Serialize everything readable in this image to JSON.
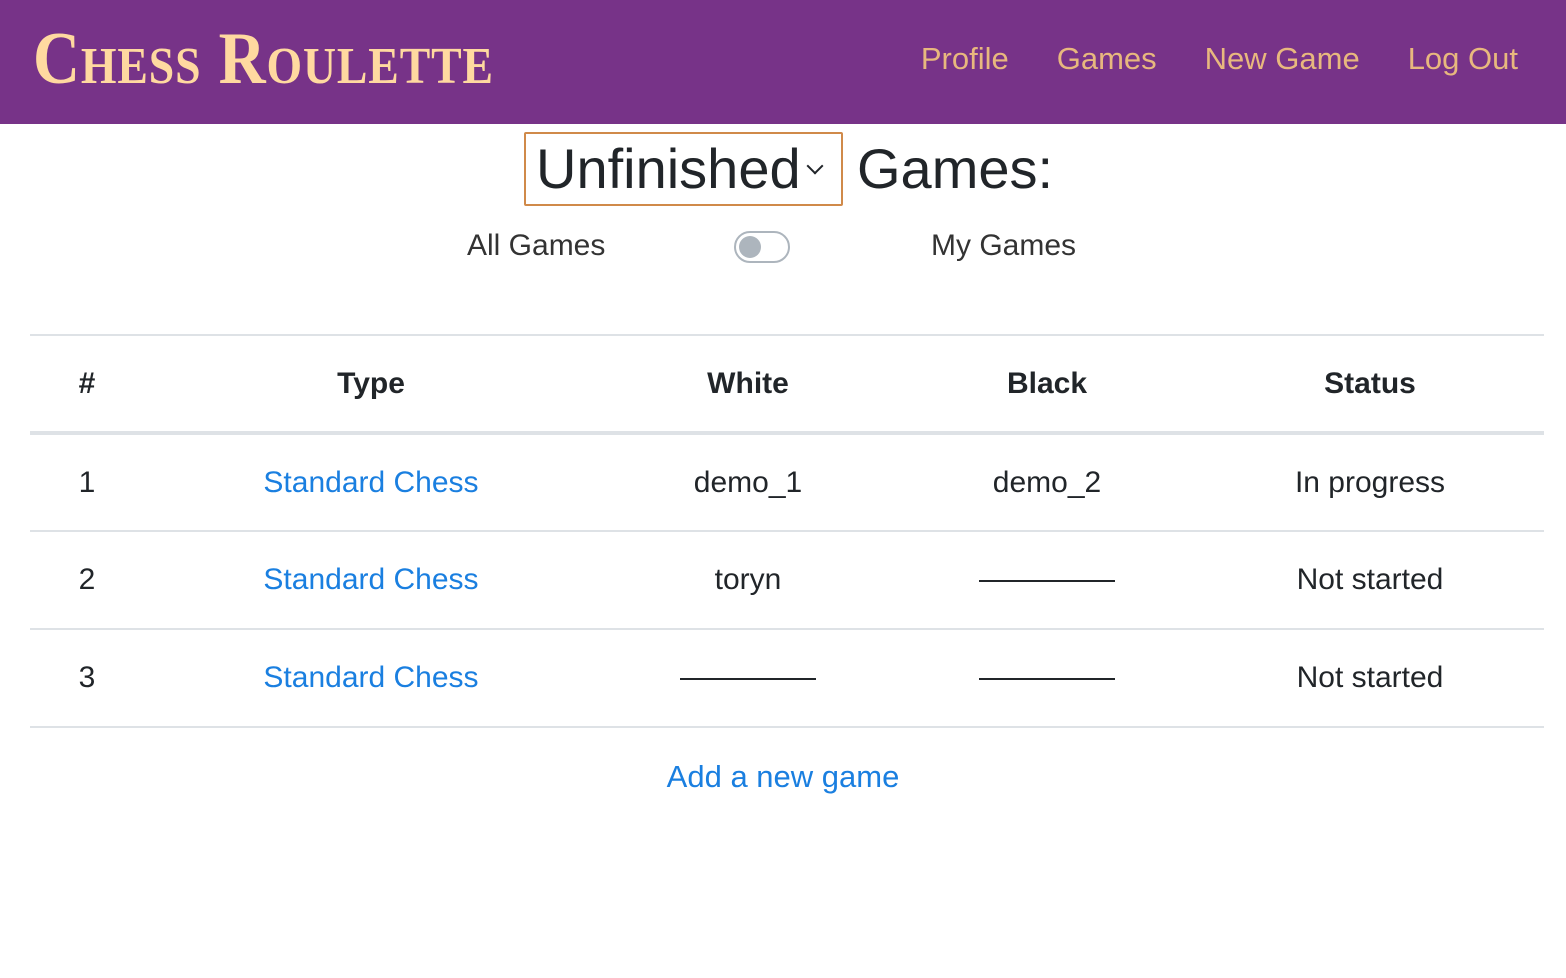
{
  "nav": {
    "brand": "Chess Roulette",
    "links": [
      "Profile",
      "Games",
      "New Game",
      "Log Out"
    ]
  },
  "heading": {
    "filter_value": "Unfinished",
    "label": "Games:"
  },
  "toggle": {
    "left_label": "All Games",
    "right_label": "My Games",
    "checked": false
  },
  "table": {
    "headers": [
      "#",
      "Type",
      "White",
      "Black",
      "Status"
    ],
    "rows": [
      {
        "num": "1",
        "type": "Standard Chess",
        "white": "demo_1",
        "black": "demo_2",
        "status": "In progress"
      },
      {
        "num": "2",
        "type": "Standard Chess",
        "white": "toryn",
        "black": "",
        "status": "Not started"
      },
      {
        "num": "3",
        "type": "Standard Chess",
        "white": "",
        "black": "",
        "status": "Not started"
      }
    ]
  },
  "add_game_label": "Add a new game",
  "colors": {
    "navbar": "#773388",
    "brand": "#ffd9a0",
    "nav_link": "#e8b87e",
    "link": "#1a7fe0",
    "select_border": "#d08a4a"
  }
}
